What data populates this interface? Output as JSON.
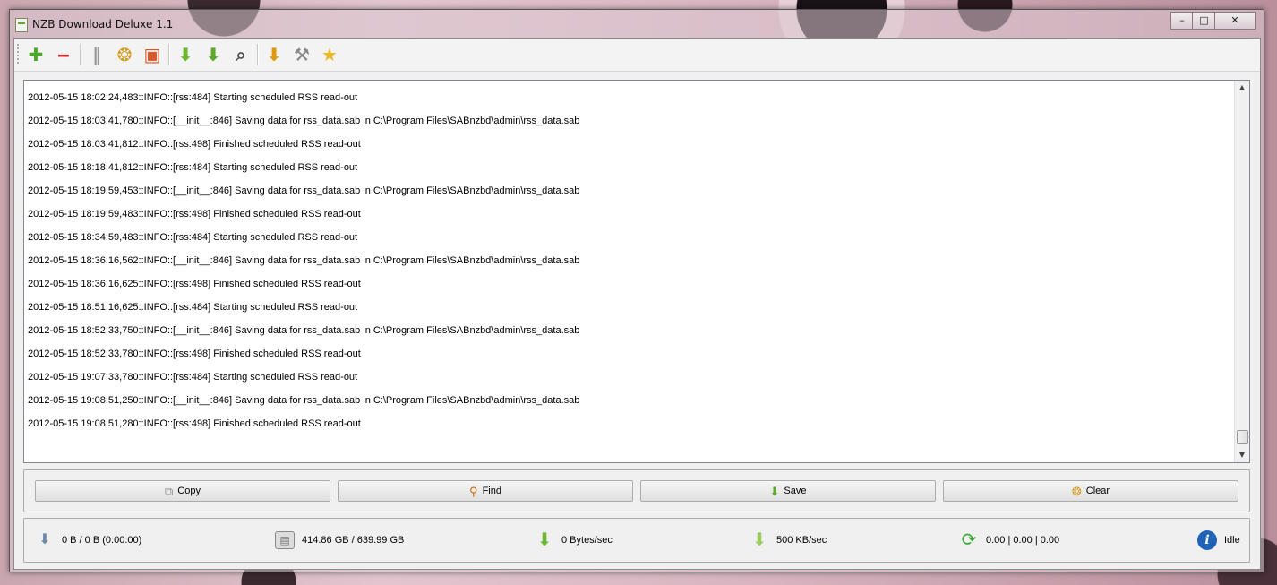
{
  "window": {
    "title": "NZB Download Deluxe 1.1",
    "controls": {
      "minimize": "–",
      "maximize": "□",
      "close": "✕"
    }
  },
  "toolbar": {
    "items": [
      {
        "name": "add-nzb-icon",
        "glyph": "✚",
        "color": "#4fa82e"
      },
      {
        "name": "remove-icon",
        "glyph": "‒",
        "color": "#d32a2a"
      },
      {
        "name": "pause-icon",
        "glyph": "‖",
        "color": "#9a9a9a"
      },
      {
        "name": "broom-clean-icon",
        "glyph": "❂",
        "color": "#d49a20"
      },
      {
        "name": "folder-icon",
        "glyph": "▣",
        "color": "#d8582a"
      },
      {
        "name": "download-arrow-icon",
        "glyph": "⬇",
        "color": "#6cb830"
      },
      {
        "name": "download-box-icon",
        "glyph": "⬇",
        "color": "#5ea82a"
      },
      {
        "name": "search-magnifier-icon",
        "glyph": "⌕",
        "color": "#555555"
      },
      {
        "name": "download-options-icon",
        "glyph": "⬇",
        "color": "#e09a10"
      },
      {
        "name": "tools-settings-icon",
        "glyph": "⚒",
        "color": "#888888"
      },
      {
        "name": "star-icon",
        "glyph": "★",
        "color": "#f0b820"
      }
    ]
  },
  "log": {
    "lines": [
      "2012-05-15 18:02:24,483::INFO::[rss:484] Starting scheduled RSS read-out",
      "2012-05-15 18:03:41,780::INFO::[__init__:846] Saving data for rss_data.sab in C:\\Program Files\\SABnzbd\\admin\\rss_data.sab",
      "2012-05-15 18:03:41,812::INFO::[rss:498] Finished scheduled RSS read-out",
      "2012-05-15 18:18:41,812::INFO::[rss:484] Starting scheduled RSS read-out",
      "2012-05-15 18:19:59,453::INFO::[__init__:846] Saving data for rss_data.sab in C:\\Program Files\\SABnzbd\\admin\\rss_data.sab",
      "2012-05-15 18:19:59,483::INFO::[rss:498] Finished scheduled RSS read-out",
      "2012-05-15 18:34:59,483::INFO::[rss:484] Starting scheduled RSS read-out",
      "2012-05-15 18:36:16,562::INFO::[__init__:846] Saving data for rss_data.sab in C:\\Program Files\\SABnzbd\\admin\\rss_data.sab",
      "2012-05-15 18:36:16,625::INFO::[rss:498] Finished scheduled RSS read-out",
      "2012-05-15 18:51:16,625::INFO::[rss:484] Starting scheduled RSS read-out",
      "2012-05-15 18:52:33,750::INFO::[__init__:846] Saving data for rss_data.sab in C:\\Program Files\\SABnzbd\\admin\\rss_data.sab",
      "2012-05-15 18:52:33,780::INFO::[rss:498] Finished scheduled RSS read-out",
      "2012-05-15 19:07:33,780::INFO::[rss:484] Starting scheduled RSS read-out",
      "2012-05-15 19:08:51,250::INFO::[__init__:846] Saving data for rss_data.sab in C:\\Program Files\\SABnzbd\\admin\\rss_data.sab",
      "2012-05-15 19:08:51,280::INFO::[rss:498] Finished scheduled RSS read-out"
    ]
  },
  "actions": {
    "copy": "Copy",
    "find": "Find",
    "save": "Save",
    "clear": "Clear"
  },
  "status": {
    "queue": "0 B / 0 B (0:00:00)",
    "disk": "414.86 GB / 639.99 GB",
    "speed": "0 Bytes/sec",
    "limit": "500 KB/sec",
    "load": "0.00 | 0.00 | 0.00",
    "state": "Idle"
  },
  "colors": {
    "accent_green": "#6cb830",
    "info_blue": "#1f63b8"
  }
}
